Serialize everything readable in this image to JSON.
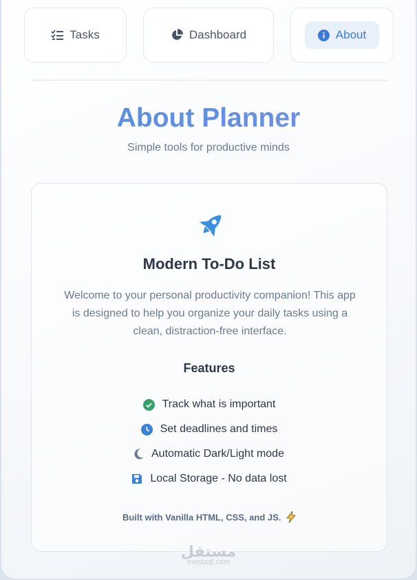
{
  "nav": {
    "tabs": [
      {
        "label": "Tasks",
        "icon": "tasks-list-icon"
      },
      {
        "label": "Dashboard",
        "icon": "pie-chart-icon"
      },
      {
        "label": "About",
        "icon": "info-icon",
        "active": true
      }
    ]
  },
  "header": {
    "title": "About Planner",
    "subtitle": "Simple tools for productive minds"
  },
  "card": {
    "icon": "rocket-icon",
    "title": "Modern To-Do List",
    "description": "Welcome to your personal productivity companion! This app is designed to help you organize your daily tasks using a clean, distraction-free interface.",
    "features_title": "Features",
    "features": [
      {
        "label": "Track what is important",
        "icon": "check-circle-icon",
        "color": "#38a169"
      },
      {
        "label": "Set deadlines and times",
        "icon": "clock-icon",
        "color": "#3b82d6"
      },
      {
        "label": "Automatic Dark/Light mode",
        "icon": "moon-icon",
        "color": "#6b7a90"
      },
      {
        "label": "Local Storage - No data lost",
        "icon": "save-icon",
        "color": "#3b82d6"
      }
    ],
    "footer": "Built with Vanilla HTML, CSS, and JS."
  },
  "watermark": {
    "arabic": "مستقل",
    "latin": "mostaql.com"
  },
  "colors": {
    "accent": "#3d7bd4",
    "title_gradient_start": "#4f8fde",
    "title_gradient_end": "#7b8fe0"
  }
}
